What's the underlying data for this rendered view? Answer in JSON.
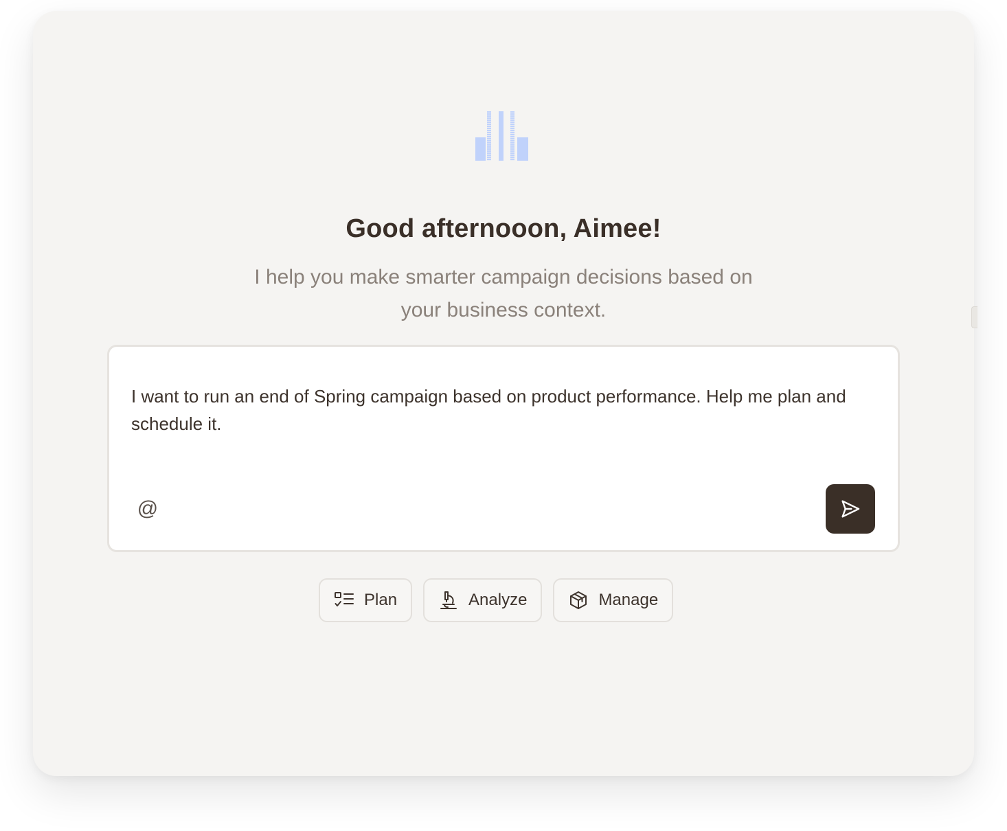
{
  "greeting": {
    "title": "Good afternooon, Aimee!",
    "subtitle": "I help you make smarter campaign decisions based on your business context."
  },
  "composer": {
    "text": "I want to run an end of Spring campaign based on product performance. Help me plan and schedule it.",
    "mention_symbol": "@",
    "send_icon": "send-icon"
  },
  "chips": [
    {
      "label": "Plan",
      "icon": "checklist-icon"
    },
    {
      "label": "Analyze",
      "icon": "microscope-icon"
    },
    {
      "label": "Manage",
      "icon": "box-icon"
    }
  ],
  "colors": {
    "card_background": "#f5f4f2",
    "logo_accent": "#c0d2fb",
    "text_primary": "#3a2f28",
    "text_secondary": "#8a817a",
    "send_button": "#3a2f27"
  }
}
